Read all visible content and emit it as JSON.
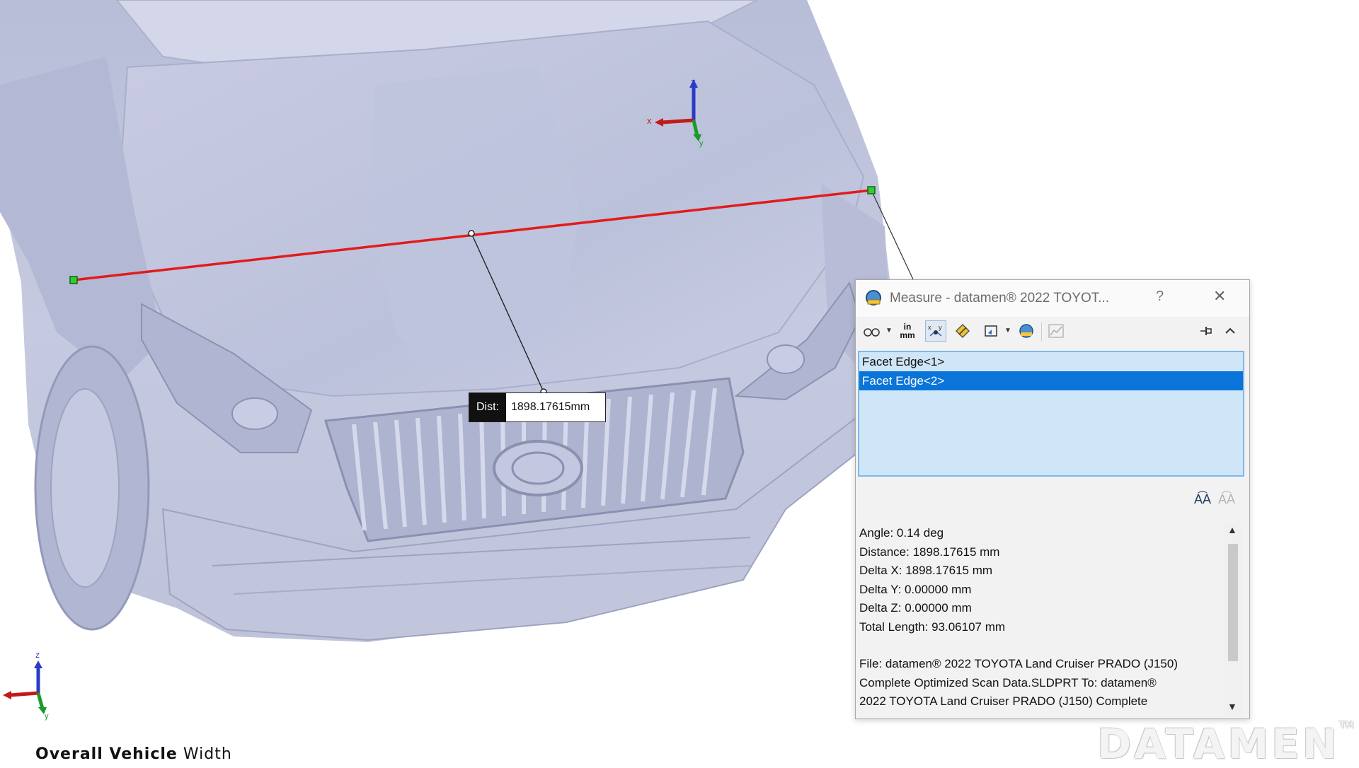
{
  "caption": {
    "bold_part": "Overall Vehicle",
    "rest": "Width"
  },
  "measurement_label": {
    "key": "Dist:",
    "value": "1898.17615mm"
  },
  "axis_labels": {
    "z": "z",
    "x": "x",
    "y": "y"
  },
  "watermark": {
    "text": "DATAMEN",
    "tm": "TM"
  },
  "dialog": {
    "title": "Measure - datamen® 2022 TOYOT...",
    "help": "?",
    "close": "✕",
    "toolbar": {
      "arc_circle_icon": "arc-circle-icon",
      "units_top": "in",
      "units_bottom": "mm",
      "xyz_icon": "xyz-dimensions-icon",
      "point_to_point_icon": "point-to-point-icon",
      "projection_icon": "projection-icon",
      "history_icon": "measurement-history-icon",
      "sensor_icon": "sensor-icon",
      "pin_icon": "pin-icon",
      "collapse_icon": "collapse-icon"
    },
    "selections": [
      {
        "label": "Facet Edge<1>",
        "selected": false
      },
      {
        "label": "Facet Edge<2>",
        "selected": true
      }
    ],
    "results": [
      "Angle: 0.14 deg",
      "Distance: 1898.17615 mm",
      "Delta X: 1898.17615 mm",
      "Delta Y: 0.00000 mm",
      "Delta Z: 0.00000 mm",
      "Total Length: 93.06107 mm"
    ],
    "file_info": [
      "File: datamen® 2022 TOYOTA Land Cruiser PRADO (J150)",
      "Complete Optimized Scan Data.SLDPRT To: datamen®",
      "2022 TOYOTA Land Cruiser PRADO (J150) Complete"
    ]
  },
  "colors": {
    "measure_line": "#e21b1b",
    "selection_highlight": "#0a74d8",
    "model_surface": "#c4c8df"
  }
}
